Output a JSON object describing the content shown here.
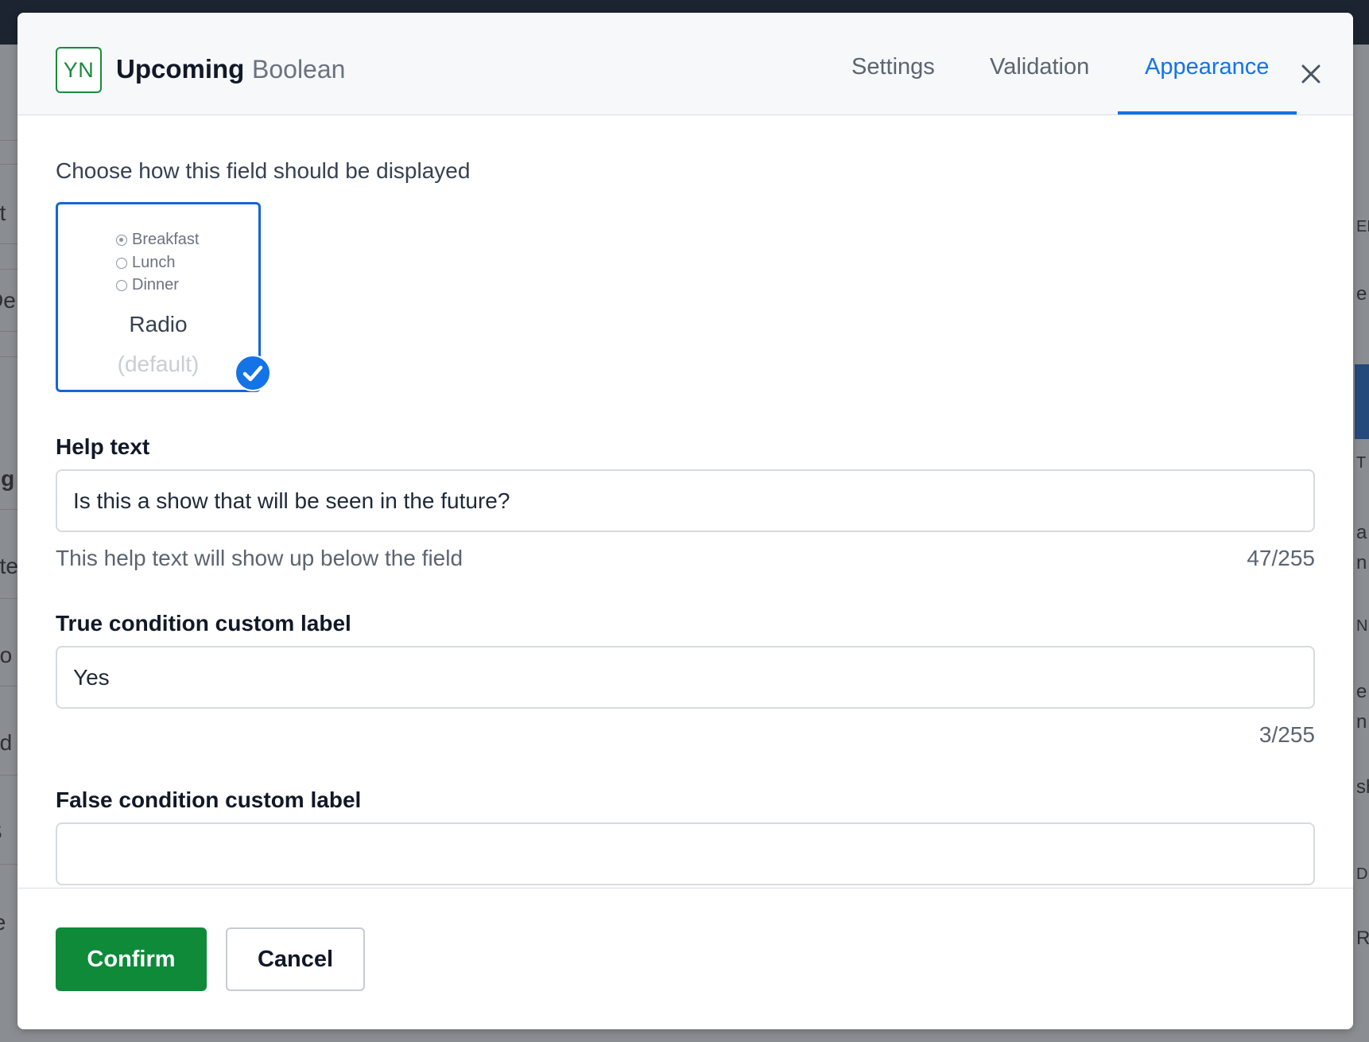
{
  "background": {
    "left_fragments": [
      "at",
      "De",
      "ng",
      "nte",
      "ho",
      "nd",
      "S",
      "te"
    ],
    "right_fragments": [
      "EL",
      "e",
      "T",
      "a",
      "n",
      "N",
      "e",
      "n",
      "sh",
      "D",
      "Rea"
    ]
  },
  "modal": {
    "field_icon": "YN",
    "field_name": "Upcoming",
    "field_type": "Boolean",
    "tabs": [
      {
        "label": "Settings",
        "active": false
      },
      {
        "label": "Validation",
        "active": false
      },
      {
        "label": "Appearance",
        "active": true
      }
    ],
    "close_icon": "close-icon"
  },
  "appearance": {
    "prompt": "Choose how this field should be displayed",
    "options": [
      {
        "title": "Radio",
        "subtitle": "(default)",
        "selected": true,
        "preview": [
          "Breakfast",
          "Lunch",
          "Dinner"
        ]
      }
    ]
  },
  "help_text": {
    "label": "Help text",
    "value": "Is this a show that will be seen in the future?",
    "hint": "This help text will show up below the field",
    "counter": "47/255"
  },
  "true_label": {
    "label": "True condition custom label",
    "value": "Yes",
    "counter": "3/255"
  },
  "false_label": {
    "label": "False condition custom label",
    "value": ""
  },
  "footer": {
    "confirm_label": "Confirm",
    "cancel_label": "Cancel"
  },
  "colors": {
    "accent_blue": "#1473e6",
    "confirm_green": "#0e8a39",
    "icon_green": "#1a8a3c"
  }
}
